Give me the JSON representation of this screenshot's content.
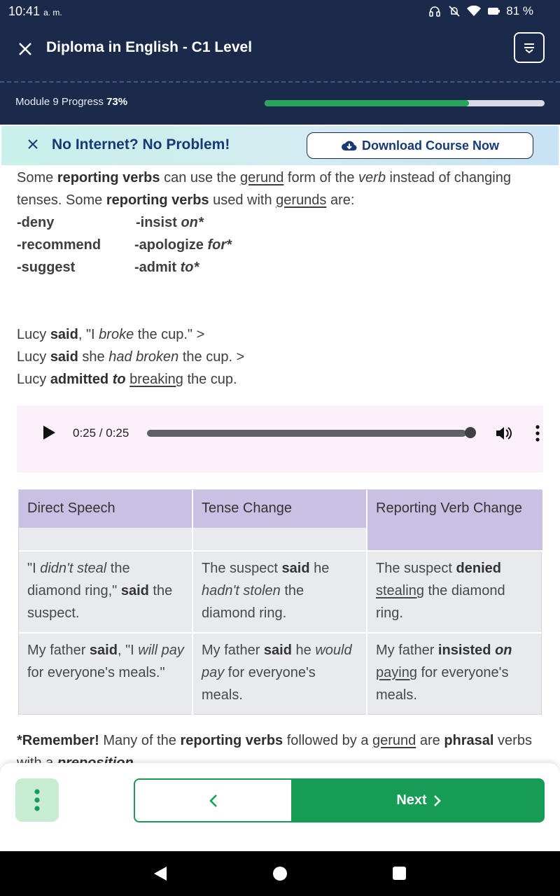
{
  "status_bar": {
    "time": "10:41",
    "ampm": "a. m.",
    "battery": "81 %"
  },
  "header": {
    "title": "Diploma in English - C1 Level"
  },
  "progress": {
    "label": "Module 9 Progress",
    "percent_text": "73%",
    "value": 0.73
  },
  "banner": {
    "text": "No Internet? No Problem!",
    "button_label": "Download Course Now"
  },
  "content": {
    "intro": {
      "t1": "Some ",
      "b1": "reporting verbs",
      "t2": " can use the ",
      "u1": "gerund",
      "t3": " form of the ",
      "i1": "verb",
      "t4": " instead of changing tenses. Some ",
      "b2": "reporting verbs",
      "t5": " used with ",
      "u2": "gerunds",
      "t6": " are:"
    },
    "verbs": [
      {
        "left": "-deny",
        "right": "-insist ",
        "right_prep": "on*"
      },
      {
        "left": "-recommend",
        "right": "-apologize ",
        "right_prep": "for*"
      },
      {
        "left": "-suggest",
        "right": "-admit ",
        "right_prep": "to*"
      }
    ],
    "example": {
      "l1_a": "Lucy ",
      "l1_b": "said",
      "l1_c": ", \"I ",
      "l1_d": "broke",
      "l1_e": " the cup.\" >",
      "l2_a": "Lucy ",
      "l2_b": "said",
      "l2_c": " she ",
      "l2_d": "had broken",
      "l2_e": " the cup. >",
      "l3_a": "Lucy ",
      "l3_b": "admitted",
      "l3_c": " ",
      "l3_d": "to",
      "l3_e": " ",
      "l3_f": "breaking",
      "l3_g": " the cup."
    }
  },
  "audio": {
    "time": "0:25 / 0:25",
    "progress": 1.0
  },
  "table": {
    "headers": [
      "Direct Speech",
      "Tense Change",
      "Reporting Verb Change"
    ],
    "row1": {
      "c1_a": "\"I ",
      "c1_b": "didn't steal",
      "c1_c": " the diamond ring,\" ",
      "c1_d": "said",
      "c1_e": " the suspect.",
      "c2_a": "The suspect ",
      "c2_b": "said",
      "c2_c": " he ",
      "c2_d": "hadn't stolen",
      "c2_e": " the diamond ring.",
      "c3_a": "The suspect ",
      "c3_b": "denied",
      "c3_c": " ",
      "c3_d": "stealing",
      "c3_e": " the diamond ring."
    },
    "row2": {
      "c1_a": "My father ",
      "c1_b": "said",
      "c1_c": ", \"I ",
      "c1_d": "will pay",
      "c1_e": " for everyone's meals.\"",
      "c2_a": "My father ",
      "c2_b": "said",
      "c2_c": " he ",
      "c2_d": "would pay",
      "c2_e": " for everyone's meals.",
      "c3_a": "My father ",
      "c3_b": "insisted",
      "c3_c": " ",
      "c3_d": "on",
      "c3_e": " ",
      "c3_f": "paying",
      "c3_g": " for everyone's meals."
    }
  },
  "remember": {
    "a": "*Remember!",
    "b": " Many of the ",
    "c": "reporting verbs",
    "d": " followed by a ",
    "e": "gerund",
    "f": " are ",
    "g": "phrasal",
    "h": " verbs with a ",
    "i": "preposition."
  },
  "bottom": {
    "next_label": "Next"
  },
  "colors": {
    "header_bg": "#1b2a4a",
    "accent_green": "#169c55",
    "table_header": "#c9c0e3"
  }
}
